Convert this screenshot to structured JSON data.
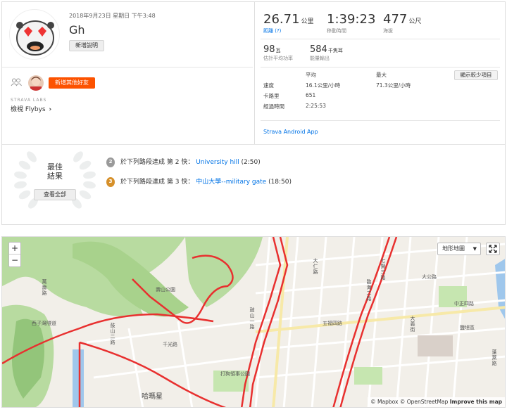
{
  "activity": {
    "datetime": "2018年9月23日 星期日 下午3:48",
    "title": "Gh",
    "add_description": "新增說明",
    "add_friends": "新增其他好友",
    "labs_label": "STRAVA LABS",
    "flybys_label": "檢視 Flybys"
  },
  "stats": {
    "distance": {
      "value": "26.71",
      "unit": "公里",
      "label": "距離 (?)"
    },
    "moving_time": {
      "value": "1:39:23",
      "label": "移動時間"
    },
    "elevation": {
      "value": "477",
      "unit": "公尺",
      "label": "海拔"
    },
    "power": {
      "value": "98",
      "unit": "瓦",
      "label": "估計平均功率"
    },
    "energy": {
      "value": "584",
      "unit": "千焦耳",
      "label": "能量輸出"
    }
  },
  "more_table": {
    "header_avg": "平均",
    "header_max": "最大",
    "show_less": "顯示較少項目",
    "rows": [
      {
        "label": "速度",
        "avg": "16.1公里/小時",
        "max": "71.3公里/小時"
      },
      {
        "label": "卡路里",
        "avg": "651",
        "max": ""
      },
      {
        "label": "經過時間",
        "avg": "2:25:53",
        "max": ""
      }
    ]
  },
  "device": "Strava Android App",
  "best_results": {
    "title_line1": "最佳",
    "title_line2": "結果",
    "view_all": "查看全部",
    "items": [
      {
        "rank_badge": "2",
        "prefix": "於下列路段達成 ",
        "rank_text": "第 2 快",
        "sep": "： ",
        "segment": "University hill",
        "time": " (2:50)",
        "badge_color": "#9a9a9a"
      },
      {
        "rank_badge": "3",
        "prefix": "於下列路段達成 ",
        "rank_text": "第 3 快",
        "sep": "： ",
        "segment": "中山大學--military gate",
        "time": " (18:50)",
        "badge_color": "#d6902a"
      }
    ]
  },
  "map": {
    "zoom_in": "+",
    "zoom_out": "−",
    "layer_select": "地形地圖",
    "attribution_mapbox": "© Mapbox",
    "attribution_osm": "© OpenStreetMap",
    "attribution_improve": "Improve this map",
    "labels": [
      "萬壽路",
      "壽山公園",
      "千光路",
      "鼓山一路",
      "五福四路",
      "七賢三路",
      "中正四路",
      "大仁路",
      "哈瑪星",
      "西子灣隧道",
      "打狗領事公園",
      "地形地圖",
      "鹽埕區",
      "臨海二路",
      "鼓山二路",
      "大公路",
      "大義街",
      "蓬萊路"
    ]
  },
  "colors": {
    "accent": "#fc5200",
    "link": "#0073e6",
    "route": "#e8302f"
  }
}
